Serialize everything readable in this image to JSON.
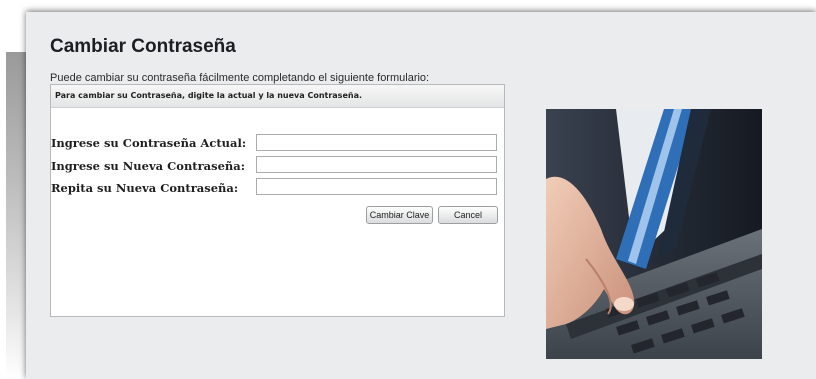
{
  "page": {
    "title": "Cambiar Contraseña",
    "intro": "Puede cambiar su contraseña fácilmente completando el siguiente formulario:"
  },
  "form": {
    "header": "Para cambiar su Contraseña, digite la actual y la nueva Contraseña.",
    "fields": [
      {
        "label": "Ingrese su Contraseña Actual:",
        "value": "",
        "placeholder": ""
      },
      {
        "label": "Ingrese su Nueva Contraseña:",
        "value": "",
        "placeholder": ""
      },
      {
        "label": "Repita su Nueva Contraseña:",
        "value": "",
        "placeholder": ""
      }
    ],
    "buttons": {
      "submit": "Cambiar Clave",
      "cancel": "Cancel"
    }
  },
  "decor": {
    "image": "business-person-typing-on-laptop",
    "colors": {
      "panel": "#eaecee",
      "suit": "#2b3340",
      "tie": "#2f6fb8",
      "laptop": "#4a5058"
    }
  }
}
